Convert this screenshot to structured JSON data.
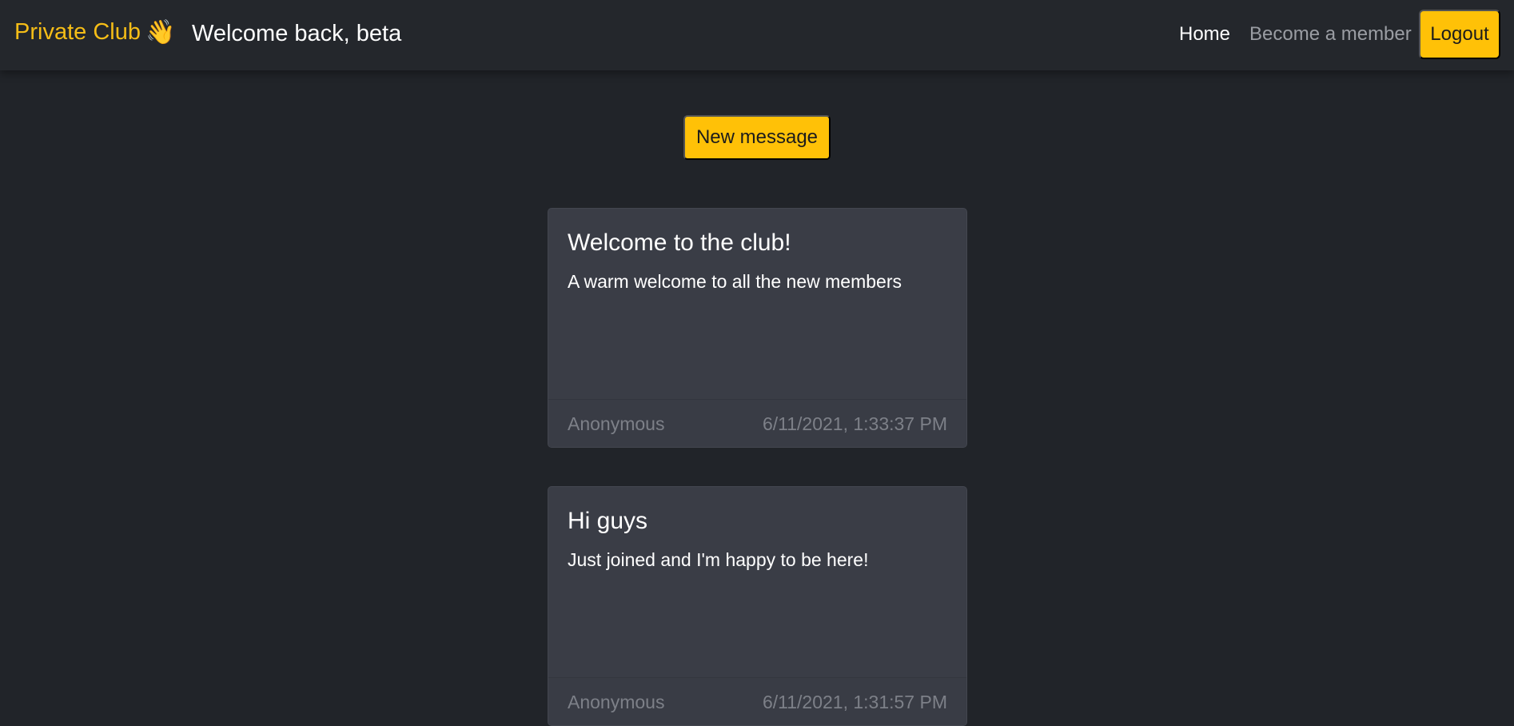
{
  "navbar": {
    "brand": "Private Club",
    "brand_icon": "👋",
    "welcome": "Welcome back, beta",
    "links": {
      "home": "Home",
      "become_member": "Become a member"
    },
    "logout": "Logout"
  },
  "actions": {
    "new_message": "New message"
  },
  "messages": [
    {
      "title": "Welcome to the club!",
      "text": "A warm welcome to all the new members",
      "author": "Anonymous",
      "timestamp": "6/11/2021, 1:33:37 PM"
    },
    {
      "title": "Hi guys",
      "text": "Just joined and I'm happy to be here!",
      "author": "Anonymous",
      "timestamp": "6/11/2021, 1:31:57 PM"
    }
  ],
  "colors": {
    "background": "#212429",
    "navbar": "#24272c",
    "accent": "#ffc107",
    "brand_text": "#f5bd17",
    "card": "#3a3d46",
    "muted_text": "#7d8088"
  }
}
